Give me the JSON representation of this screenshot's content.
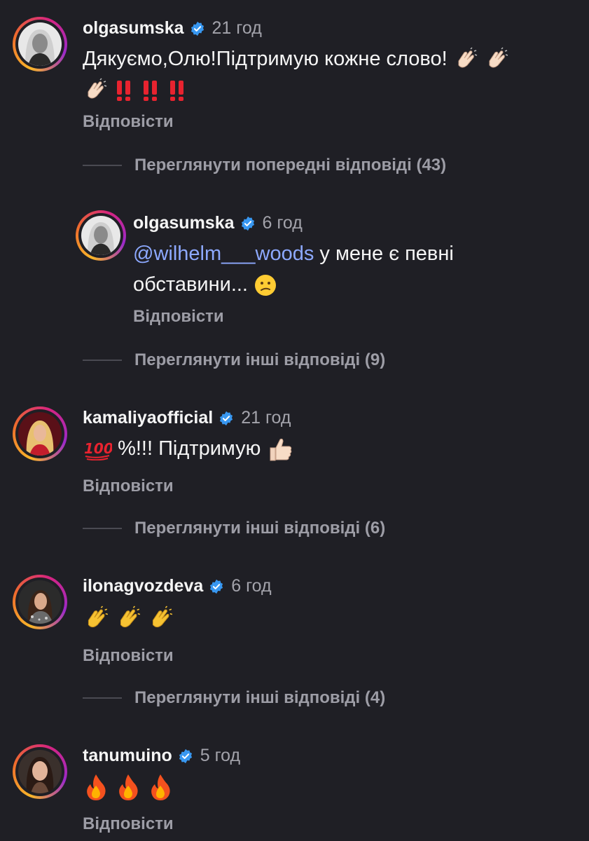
{
  "comments": [
    {
      "username": "olgasumska",
      "time": "21 год",
      "text_line1": "Дякуємо,Олю!Підтримую кожне слово!",
      "reply_label": "Відповісти",
      "thread_label": "Переглянути попередні відповіді (43)"
    },
    {
      "username": "olgasumska",
      "time": "6 год",
      "mention": "@wilhelm___woods",
      "text_rest": " у мене є певні",
      "text_line2": "обставини...",
      "reply_label": "Відповісти",
      "thread_label": "Переглянути інші відповіді (9)"
    },
    {
      "username": "kamaliyaofficial",
      "time": "21 год",
      "text": "%!!! Підтримую",
      "reply_label": "Відповісти",
      "thread_label": "Переглянути інші відповіді (6)"
    },
    {
      "username": "ilonagvozdeva",
      "time": "6 год",
      "reply_label": "Відповісти",
      "thread_label": "Переглянути інші відповіді (4)"
    },
    {
      "username": "tanumuino",
      "time": "5 год",
      "reply_label": "Відповісти"
    }
  ],
  "icons": {
    "verified": "verified-badge-icon",
    "clap": "clapping-hands-emoji",
    "exclamation": "double-exclamation-emoji",
    "confused": "confused-face-emoji",
    "hundred": "hundred-points-emoji",
    "thumbs_up": "thumbs-up-emoji",
    "fire": "fire-emoji"
  },
  "colors": {
    "background": "#1f1f25",
    "mention": "#8da9ff",
    "verified": "#3897f0",
    "muted": "#9d9da6"
  }
}
